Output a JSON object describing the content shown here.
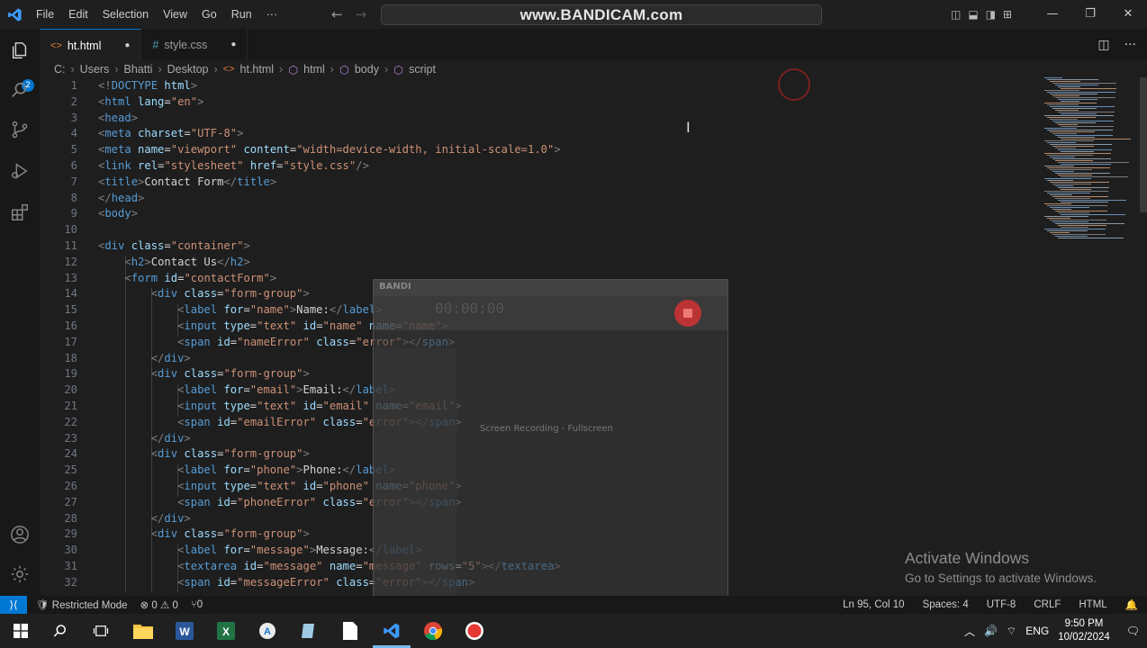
{
  "menu": [
    "File",
    "Edit",
    "Selection",
    "View",
    "Go",
    "Run",
    "···"
  ],
  "command_center": "www.BANDICAM.com",
  "tabs": [
    {
      "icon": "<>",
      "label": "ht.html",
      "modified": "●"
    },
    {
      "icon": "#",
      "label": "style.css",
      "modified": "●"
    }
  ],
  "breadcrumb": [
    "C:",
    "Users",
    "Bhatti",
    "Desktop",
    "ht.html",
    "html",
    "body",
    "script"
  ],
  "code_lines": [
    {
      "n": "1",
      "indent": 0,
      "parts": [
        [
          "tg",
          "<!"
        ],
        [
          "tn",
          "DOCTYPE"
        ],
        [
          "tx",
          " "
        ],
        [
          "at",
          "html"
        ],
        [
          "tg",
          ">"
        ]
      ]
    },
    {
      "n": "2",
      "indent": 0,
      "parts": [
        [
          "tg",
          "<"
        ],
        [
          "tn",
          "html"
        ],
        [
          "tx",
          " "
        ],
        [
          "at",
          "lang"
        ],
        [
          "tx",
          "="
        ],
        [
          "sv",
          "\"en\""
        ],
        [
          "tg",
          ">"
        ]
      ]
    },
    {
      "n": "3",
      "indent": 0,
      "parts": [
        [
          "tg",
          "<"
        ],
        [
          "tn",
          "head"
        ],
        [
          "tg",
          ">"
        ]
      ]
    },
    {
      "n": "4",
      "indent": 0,
      "parts": [
        [
          "tg",
          "<"
        ],
        [
          "tn",
          "meta"
        ],
        [
          "tx",
          " "
        ],
        [
          "at",
          "charset"
        ],
        [
          "tx",
          "="
        ],
        [
          "sv",
          "\"UTF-8\""
        ],
        [
          "tg",
          ">"
        ]
      ]
    },
    {
      "n": "5",
      "indent": 0,
      "parts": [
        [
          "tg",
          "<"
        ],
        [
          "tn",
          "meta"
        ],
        [
          "tx",
          " "
        ],
        [
          "at",
          "name"
        ],
        [
          "tx",
          "="
        ],
        [
          "sv",
          "\"viewport\""
        ],
        [
          "tx",
          " "
        ],
        [
          "at",
          "content"
        ],
        [
          "tx",
          "="
        ],
        [
          "sv",
          "\"width=device-width, initial-scale=1.0\""
        ],
        [
          "tg",
          ">"
        ]
      ]
    },
    {
      "n": "6",
      "indent": 0,
      "parts": [
        [
          "tg",
          "<"
        ],
        [
          "tn",
          "link"
        ],
        [
          "tx",
          " "
        ],
        [
          "at",
          "rel"
        ],
        [
          "tx",
          "="
        ],
        [
          "sv",
          "\"stylesheet\""
        ],
        [
          "tx",
          " "
        ],
        [
          "at",
          "href"
        ],
        [
          "tx",
          "="
        ],
        [
          "sv",
          "\"style.css\""
        ],
        [
          "tg",
          "/>"
        ]
      ]
    },
    {
      "n": "7",
      "indent": 0,
      "parts": [
        [
          "tg",
          "<"
        ],
        [
          "tn",
          "title"
        ],
        [
          "tg",
          ">"
        ],
        [
          "tx",
          "Contact Form"
        ],
        [
          "tg",
          "</"
        ],
        [
          "tn",
          "title"
        ],
        [
          "tg",
          ">"
        ]
      ]
    },
    {
      "n": "8",
      "indent": 0,
      "parts": [
        [
          "tg",
          "</"
        ],
        [
          "tn",
          "head"
        ],
        [
          "tg",
          ">"
        ]
      ]
    },
    {
      "n": "9",
      "indent": 0,
      "parts": [
        [
          "tg",
          "<"
        ],
        [
          "tn",
          "body"
        ],
        [
          "tg",
          ">"
        ]
      ]
    },
    {
      "n": "10",
      "indent": 0,
      "parts": []
    },
    {
      "n": "11",
      "indent": 0,
      "parts": [
        [
          "tg",
          "<"
        ],
        [
          "tn",
          "div"
        ],
        [
          "tx",
          " "
        ],
        [
          "at",
          "class"
        ],
        [
          "tx",
          "="
        ],
        [
          "sv",
          "\"container\""
        ],
        [
          "tg",
          ">"
        ]
      ]
    },
    {
      "n": "12",
      "indent": 1,
      "parts": [
        [
          "tg",
          "<"
        ],
        [
          "tn",
          "h2"
        ],
        [
          "tg",
          ">"
        ],
        [
          "tx",
          "Contact Us"
        ],
        [
          "tg",
          "</"
        ],
        [
          "tn",
          "h2"
        ],
        [
          "tg",
          ">"
        ]
      ]
    },
    {
      "n": "13",
      "indent": 1,
      "parts": [
        [
          "tg",
          "<"
        ],
        [
          "tn",
          "form"
        ],
        [
          "tx",
          " "
        ],
        [
          "at",
          "id"
        ],
        [
          "tx",
          "="
        ],
        [
          "sv",
          "\"contactForm\""
        ],
        [
          "tg",
          ">"
        ]
      ]
    },
    {
      "n": "14",
      "indent": 2,
      "parts": [
        [
          "tg",
          "<"
        ],
        [
          "tn",
          "div"
        ],
        [
          "tx",
          " "
        ],
        [
          "at",
          "class"
        ],
        [
          "tx",
          "="
        ],
        [
          "sv",
          "\"form-group\""
        ],
        [
          "tg",
          ">"
        ]
      ]
    },
    {
      "n": "15",
      "indent": 3,
      "parts": [
        [
          "tg",
          "<"
        ],
        [
          "tn",
          "label"
        ],
        [
          "tx",
          " "
        ],
        [
          "at",
          "for"
        ],
        [
          "tx",
          "="
        ],
        [
          "sv",
          "\"name\""
        ],
        [
          "tg",
          ">"
        ],
        [
          "tx",
          "Name:"
        ],
        [
          "tg",
          "</"
        ],
        [
          "tn",
          "label"
        ],
        [
          "tg",
          ">"
        ]
      ]
    },
    {
      "n": "16",
      "indent": 3,
      "parts": [
        [
          "tg",
          "<"
        ],
        [
          "tn",
          "input"
        ],
        [
          "tx",
          " "
        ],
        [
          "at",
          "type"
        ],
        [
          "tx",
          "="
        ],
        [
          "sv",
          "\"text\""
        ],
        [
          "tx",
          " "
        ],
        [
          "at",
          "id"
        ],
        [
          "tx",
          "="
        ],
        [
          "sv",
          "\"name\""
        ],
        [
          "tx",
          " "
        ],
        [
          "at",
          "name"
        ],
        [
          "tx",
          "="
        ],
        [
          "sv",
          "\"name\""
        ],
        [
          "tg",
          ">"
        ]
      ]
    },
    {
      "n": "17",
      "indent": 3,
      "parts": [
        [
          "tg",
          "<"
        ],
        [
          "tn",
          "span"
        ],
        [
          "tx",
          " "
        ],
        [
          "at",
          "id"
        ],
        [
          "tx",
          "="
        ],
        [
          "sv",
          "\"nameError\""
        ],
        [
          "tx",
          " "
        ],
        [
          "at",
          "class"
        ],
        [
          "tx",
          "="
        ],
        [
          "sv",
          "\"error\""
        ],
        [
          "tg",
          "></"
        ],
        [
          "tn",
          "span"
        ],
        [
          "tg",
          ">"
        ]
      ]
    },
    {
      "n": "18",
      "indent": 2,
      "parts": [
        [
          "tg",
          "</"
        ],
        [
          "tn",
          "div"
        ],
        [
          "tg",
          ">"
        ]
      ]
    },
    {
      "n": "19",
      "indent": 2,
      "parts": [
        [
          "tg",
          "<"
        ],
        [
          "tn",
          "div"
        ],
        [
          "tx",
          " "
        ],
        [
          "at",
          "class"
        ],
        [
          "tx",
          "="
        ],
        [
          "sv",
          "\"form-group\""
        ],
        [
          "tg",
          ">"
        ]
      ]
    },
    {
      "n": "20",
      "indent": 3,
      "parts": [
        [
          "tg",
          "<"
        ],
        [
          "tn",
          "label"
        ],
        [
          "tx",
          " "
        ],
        [
          "at",
          "for"
        ],
        [
          "tx",
          "="
        ],
        [
          "sv",
          "\"email\""
        ],
        [
          "tg",
          ">"
        ],
        [
          "tx",
          "Email:"
        ],
        [
          "tg",
          "</"
        ],
        [
          "tn",
          "label"
        ],
        [
          "tg",
          ">"
        ]
      ]
    },
    {
      "n": "21",
      "indent": 3,
      "parts": [
        [
          "tg",
          "<"
        ],
        [
          "tn",
          "input"
        ],
        [
          "tx",
          " "
        ],
        [
          "at",
          "type"
        ],
        [
          "tx",
          "="
        ],
        [
          "sv",
          "\"text\""
        ],
        [
          "tx",
          " "
        ],
        [
          "at",
          "id"
        ],
        [
          "tx",
          "="
        ],
        [
          "sv",
          "\"email\""
        ],
        [
          "tx",
          " "
        ],
        [
          "at",
          "name"
        ],
        [
          "tx",
          "="
        ],
        [
          "sv",
          "\"email\""
        ],
        [
          "tg",
          ">"
        ]
      ]
    },
    {
      "n": "22",
      "indent": 3,
      "parts": [
        [
          "tg",
          "<"
        ],
        [
          "tn",
          "span"
        ],
        [
          "tx",
          " "
        ],
        [
          "at",
          "id"
        ],
        [
          "tx",
          "="
        ],
        [
          "sv",
          "\"emailError\""
        ],
        [
          "tx",
          " "
        ],
        [
          "at",
          "class"
        ],
        [
          "tx",
          "="
        ],
        [
          "sv",
          "\"error\""
        ],
        [
          "tg",
          "></"
        ],
        [
          "tn",
          "span"
        ],
        [
          "tg",
          ">"
        ]
      ]
    },
    {
      "n": "23",
      "indent": 2,
      "parts": [
        [
          "tg",
          "</"
        ],
        [
          "tn",
          "div"
        ],
        [
          "tg",
          ">"
        ]
      ]
    },
    {
      "n": "24",
      "indent": 2,
      "parts": [
        [
          "tg",
          "<"
        ],
        [
          "tn",
          "div"
        ],
        [
          "tx",
          " "
        ],
        [
          "at",
          "class"
        ],
        [
          "tx",
          "="
        ],
        [
          "sv",
          "\"form-group\""
        ],
        [
          "tg",
          ">"
        ]
      ]
    },
    {
      "n": "25",
      "indent": 3,
      "parts": [
        [
          "tg",
          "<"
        ],
        [
          "tn",
          "label"
        ],
        [
          "tx",
          " "
        ],
        [
          "at",
          "for"
        ],
        [
          "tx",
          "="
        ],
        [
          "sv",
          "\"phone\""
        ],
        [
          "tg",
          ">"
        ],
        [
          "tx",
          "Phone:"
        ],
        [
          "tg",
          "</"
        ],
        [
          "tn",
          "label"
        ],
        [
          "tg",
          ">"
        ]
      ]
    },
    {
      "n": "26",
      "indent": 3,
      "parts": [
        [
          "tg",
          "<"
        ],
        [
          "tn",
          "input"
        ],
        [
          "tx",
          " "
        ],
        [
          "at",
          "type"
        ],
        [
          "tx",
          "="
        ],
        [
          "sv",
          "\"text\""
        ],
        [
          "tx",
          " "
        ],
        [
          "at",
          "id"
        ],
        [
          "tx",
          "="
        ],
        [
          "sv",
          "\"phone\""
        ],
        [
          "tx",
          " "
        ],
        [
          "at",
          "name"
        ],
        [
          "tx",
          "="
        ],
        [
          "sv",
          "\"phone\""
        ],
        [
          "tg",
          ">"
        ]
      ]
    },
    {
      "n": "27",
      "indent": 3,
      "parts": [
        [
          "tg",
          "<"
        ],
        [
          "tn",
          "span"
        ],
        [
          "tx",
          " "
        ],
        [
          "at",
          "id"
        ],
        [
          "tx",
          "="
        ],
        [
          "sv",
          "\"phoneError\""
        ],
        [
          "tx",
          " "
        ],
        [
          "at",
          "class"
        ],
        [
          "tx",
          "="
        ],
        [
          "sv",
          "\"error\""
        ],
        [
          "tg",
          "></"
        ],
        [
          "tn",
          "span"
        ],
        [
          "tg",
          ">"
        ]
      ]
    },
    {
      "n": "28",
      "indent": 2,
      "parts": [
        [
          "tg",
          "</"
        ],
        [
          "tn",
          "div"
        ],
        [
          "tg",
          ">"
        ]
      ]
    },
    {
      "n": "29",
      "indent": 2,
      "parts": [
        [
          "tg",
          "<"
        ],
        [
          "tn",
          "div"
        ],
        [
          "tx",
          " "
        ],
        [
          "at",
          "class"
        ],
        [
          "tx",
          "="
        ],
        [
          "sv",
          "\"form-group\""
        ],
        [
          "tg",
          ">"
        ]
      ]
    },
    {
      "n": "30",
      "indent": 3,
      "parts": [
        [
          "tg",
          "<"
        ],
        [
          "tn",
          "label"
        ],
        [
          "tx",
          " "
        ],
        [
          "at",
          "for"
        ],
        [
          "tx",
          "="
        ],
        [
          "sv",
          "\"message\""
        ],
        [
          "tg",
          ">"
        ],
        [
          "tx",
          "Message:"
        ],
        [
          "tg",
          "</"
        ],
        [
          "tn",
          "label"
        ],
        [
          "tg",
          ">"
        ]
      ]
    },
    {
      "n": "31",
      "indent": 3,
      "parts": [
        [
          "tg",
          "<"
        ],
        [
          "tn",
          "textarea"
        ],
        [
          "tx",
          " "
        ],
        [
          "at",
          "id"
        ],
        [
          "tx",
          "="
        ],
        [
          "sv",
          "\"message\""
        ],
        [
          "tx",
          " "
        ],
        [
          "at",
          "name"
        ],
        [
          "tx",
          "="
        ],
        [
          "sv",
          "\"message\""
        ],
        [
          "tx",
          " "
        ],
        [
          "at",
          "rows"
        ],
        [
          "tx",
          "="
        ],
        [
          "sv",
          "\"5\""
        ],
        [
          "tg",
          "></"
        ],
        [
          "tn",
          "textarea"
        ],
        [
          "tg",
          ">"
        ]
      ]
    },
    {
      "n": "32",
      "indent": 3,
      "parts": [
        [
          "tg",
          "<"
        ],
        [
          "tn",
          "span"
        ],
        [
          "tx",
          " "
        ],
        [
          "at",
          "id"
        ],
        [
          "tx",
          "="
        ],
        [
          "sv",
          "\"messageError\""
        ],
        [
          "tx",
          " "
        ],
        [
          "at",
          "class"
        ],
        [
          "tx",
          "="
        ],
        [
          "sv",
          "\"error\""
        ],
        [
          "tg",
          "></"
        ],
        [
          "tn",
          "span"
        ],
        [
          "tg",
          ">"
        ]
      ]
    }
  ],
  "bandicam": {
    "logo": "BANDI",
    "timer": "00:00:00",
    "title": "Screen Recording - Fullscreen"
  },
  "watermark": {
    "line1": "Activate Windows",
    "line2": "Go to Settings to activate Windows."
  },
  "status": {
    "mode": "Restricted Mode",
    "errors": "⊗ 0 ⚠ 0",
    "ports": "⑂0",
    "position": "Ln 95, Col 10",
    "spaces": "Spaces: 4",
    "encoding": "UTF-8",
    "eol": "CRLF",
    "language": "HTML"
  },
  "tray": {
    "lang": "ENG",
    "time": "9:50 PM",
    "date": "10/02/2024"
  },
  "colors": {
    "accent": "#0078d4",
    "tag_name": "#569cd6",
    "attribute": "#9cdcfe",
    "string": "#ce9178"
  }
}
